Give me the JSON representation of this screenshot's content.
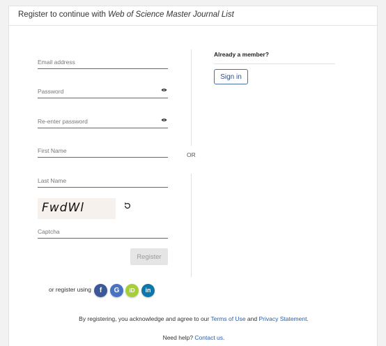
{
  "header": {
    "prefix": "Register to continue with ",
    "product": "Web of Science Master Journal List"
  },
  "form": {
    "email_placeholder": "Email address",
    "password_placeholder": "Password",
    "reenter_placeholder": "Re-enter password",
    "first_name_placeholder": "First Name",
    "last_name_placeholder": "Last Name",
    "captcha_image_text": "FwdWl",
    "captcha_placeholder": "Captcha",
    "register_label": "Register"
  },
  "divider": {
    "or": "OR"
  },
  "member": {
    "title": "Already a member?",
    "signin_label": "Sign in"
  },
  "social": {
    "label": "or register using",
    "facebook": "f",
    "google": "G",
    "orcid": "iD",
    "linkedin": "in",
    "colors": {
      "facebook": "#3b5998",
      "google": "#4a72c4",
      "orcid": "#a6ce39",
      "linkedin": "#0e76a8"
    }
  },
  "footer": {
    "ack_prefix": "By registering, you acknowledge and agree to our ",
    "terms": "Terms of Use",
    "and": " and ",
    "privacy": "Privacy Statement",
    "period": ".",
    "help_prefix": "Need help? ",
    "contact": "Contact us",
    "help_period": "."
  }
}
